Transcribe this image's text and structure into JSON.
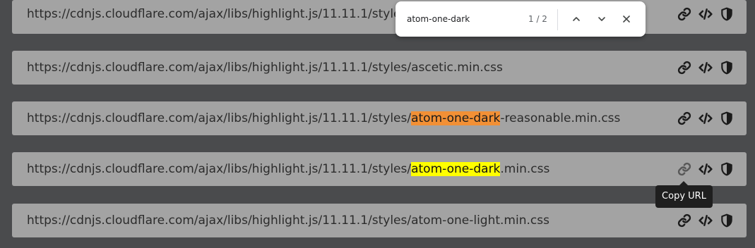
{
  "rows": [
    {
      "prefix": "https://cdnjs.cloudflare.com/ajax/libs/highlight.js/11.11.1/styles/",
      "match": "",
      "suffix": ""
    },
    {
      "prefix": "https://cdnjs.cloudflare.com/ajax/libs/highlight.js/11.11.1/styles/ascetic.min.css",
      "match": "",
      "suffix": ""
    },
    {
      "prefix": "https://cdnjs.cloudflare.com/ajax/libs/highlight.js/11.11.1/styles/",
      "match": "atom-one-dark",
      "suffix": "-reasonable.min.css"
    },
    {
      "prefix": "https://cdnjs.cloudflare.com/ajax/libs/highlight.js/11.11.1/styles/",
      "match": "atom-one-dark",
      "suffix": ".min.css"
    },
    {
      "prefix": "https://cdnjs.cloudflare.com/ajax/libs/highlight.js/11.11.1/styles/atom-one-light.min.css",
      "match": "",
      "suffix": ""
    }
  ],
  "icons": {
    "link": "link-icon",
    "code": "code-icon",
    "shield": "shield-icon"
  },
  "find_bar": {
    "query": "atom-one-dark",
    "match_count": "1 / 2"
  },
  "tooltip": {
    "text": "Copy URL"
  },
  "colors": {
    "background": "#4a4b4d",
    "row": "#a3a3a3",
    "active_match": "#f29035",
    "match": "#ffff00",
    "tooltip": "#1f1f1f"
  }
}
